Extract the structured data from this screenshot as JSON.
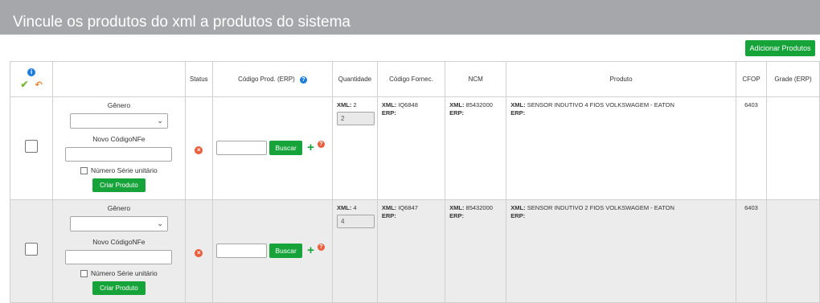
{
  "header": {
    "title": "Vincule os produtos do xml a produtos do sistema"
  },
  "toolbar": {
    "add_products_label": "Adicionar Produtos"
  },
  "table": {
    "columns": [
      "Status",
      "Código Prod. (ERP)",
      "Quantidade",
      "Código Fornec.",
      "NCM",
      "Produto",
      "CFOP",
      "Grade (ERP)"
    ],
    "rows": [
      {
        "genero_label": "Gênero",
        "novo_codigo_label": "Novo CódigoNFe",
        "numero_serie_label": "Número Série unitário",
        "criar_label": "Criar Produto",
        "buscar_label": "Buscar",
        "qty_xml_prefix": "XML:",
        "qty_xml_value": "2",
        "qty_input": "2",
        "fornec_xml_prefix": "XML:",
        "fornec_xml_value": "IQ6848",
        "fornec_erp_prefix": "ERP:",
        "ncm_xml_prefix": "XML:",
        "ncm_xml_value": "85432000",
        "ncm_erp_prefix": "ERP:",
        "produto_xml_prefix": "XML:",
        "produto_xml_value": "SENSOR INDUTIVO 4 FIOS VOLKSWAGEM - EATON",
        "produto_erp_prefix": "ERP:",
        "cfop": "6403"
      },
      {
        "genero_label": "Gênero",
        "novo_codigo_label": "Novo CódigoNFe",
        "numero_serie_label": "Número Série unitário",
        "criar_label": "Criar Produto",
        "buscar_label": "Buscar",
        "qty_xml_prefix": "XML:",
        "qty_xml_value": "4",
        "qty_input": "4",
        "fornec_xml_prefix": "XML:",
        "fornec_xml_value": "IQ6847",
        "fornec_erp_prefix": "ERP:",
        "ncm_xml_prefix": "XML:",
        "ncm_xml_value": "85432000",
        "ncm_erp_prefix": "ERP:",
        "produto_xml_prefix": "XML:",
        "produto_xml_value": "SENSOR INDUTIVO 2 FIOS VOLKSWAGEM - EATON",
        "produto_erp_prefix": "ERP:",
        "cfop": "6403"
      }
    ]
  },
  "icons": {
    "info": "i",
    "check": "✔",
    "undo": "↶",
    "help": "?",
    "remove": "×",
    "plus": "+",
    "chevron": "⌄"
  },
  "colors": {
    "header_bg": "#a6a7ab",
    "accent_green": "#16a33a",
    "info_blue": "#1e7dd8",
    "status_red": "#e85d3b"
  }
}
